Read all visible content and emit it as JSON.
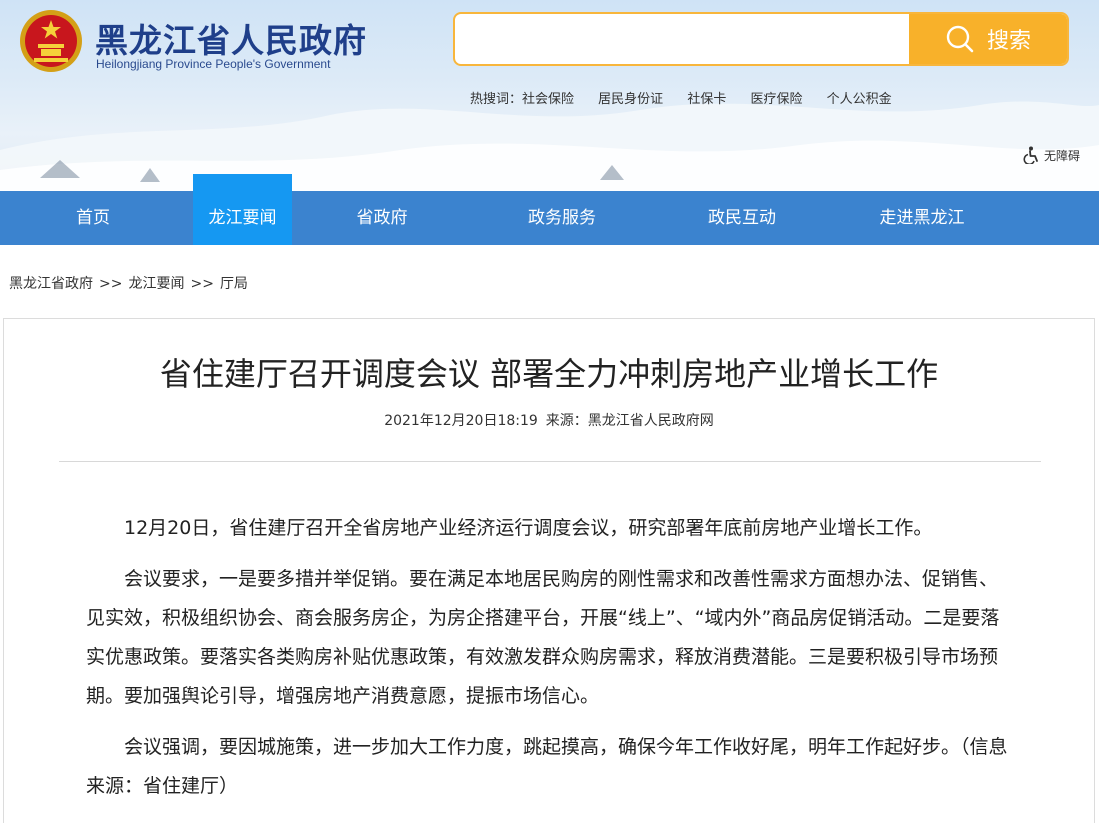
{
  "header": {
    "logo_cn": "黑龙江省人民政府",
    "logo_en": "Heilongjiang Province People's Government",
    "search": {
      "placeholder": "",
      "button_label": "搜索"
    },
    "hotwords": {
      "label": "热搜词：",
      "items": [
        "社会保险",
        "居民身份证",
        "社保卡",
        "医疗保险",
        "个人公积金"
      ]
    },
    "accessibility_label": "无障碍"
  },
  "nav": {
    "items": [
      "首页",
      "龙江要闻",
      "省政府",
      "政务服务",
      "政民互动",
      "走进黑龙江"
    ],
    "active_index": 1
  },
  "breadcrumb": {
    "items": [
      "黑龙江省政府",
      "龙江要闻",
      "厅局"
    ],
    "separator": ">>"
  },
  "article": {
    "title": "省住建厅召开调度会议 部署全力冲刺房地产业增长工作",
    "datetime": "2021年12月20日18:19",
    "source": "来源：黑龙江省人民政府网",
    "paragraphs": [
      "12月20日，省住建厅召开全省房地产业经济运行调度会议，研究部署年底前房地产业增长工作。",
      "会议要求，一是要多措并举促销。要在满足本地居民购房的刚性需求和改善性需求方面想办法、促销售、见实效，积极组织协会、商会服务房企，为房企搭建平台，开展“线上”、“域内外”商品房促销活动。二是要落实优惠政策。要落实各类购房补贴优惠政策，有效激发群众购房需求，释放消费潜能。三是要积极引导市场预期。要加强舆论引导，增强房地产消费意愿，提振市场信心。",
      "会议强调，要因城施策，进一步加大工作力度，跳起摸高，确保今年工作收好尾，明年工作起好步。（信息来源：省住建厅）"
    ]
  },
  "colors": {
    "nav_bg": "#3b83cf",
    "nav_active": "#1598f2",
    "search_accent": "#f8b12a",
    "logo_text": "#1f3f8a"
  }
}
